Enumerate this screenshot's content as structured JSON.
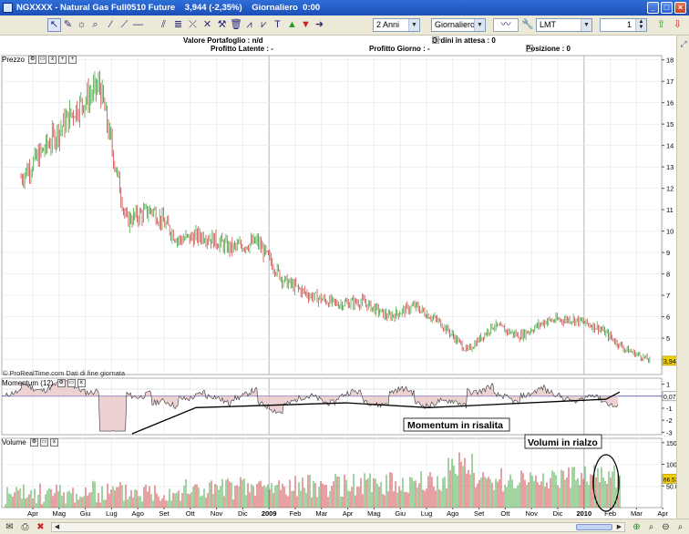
{
  "window": {
    "title": "NGXXXX - Natural Gas Full0510 Future",
    "price_change": "3,944 (-2,35%)",
    "timeframe": "Giornaliero",
    "time": "0:00"
  },
  "toolbar": {
    "period_select": "2 Anni",
    "interval_select": "Giornaliero",
    "order_type_select": "LMT",
    "quantity": "1"
  },
  "info": {
    "valore_portafoglio": "Valore Portafoglio : n/d",
    "profitto_latente": "Profitto Latente : -",
    "profitto_giorno": "Profitto Giorno : -",
    "ordini_in_attesa": "Ordini in attesa : 0",
    "posizione": "Posizione : 0"
  },
  "panels": {
    "price_label": "Prezzo",
    "momentum_label": "Momentum (12)",
    "volume_label": "Volume",
    "source_note": "© ProRealTime.com  Dati di fine giornata"
  },
  "annotations": {
    "momentum": "Momentum in risalita",
    "volume": "Volumi in rialzo"
  },
  "colors": {
    "up": "#44aa44",
    "down": "#cc4444",
    "grid": "#e6e6e6",
    "last_price_bg": "#f2d100"
  },
  "chart_data": [
    {
      "type": "candlestick",
      "name": "Prezzo",
      "y_ticks": [
        4,
        5,
        6,
        7,
        8,
        9,
        10,
        11,
        12,
        13,
        14,
        15,
        16,
        17,
        18
      ],
      "ylim": [
        3.3,
        18.2
      ],
      "last_price": "3,944",
      "x": [
        "2008-04",
        "2008-05",
        "2008-06",
        "2008-07",
        "2008-08",
        "2008-09",
        "2008-10",
        "2008-11",
        "2008-12",
        "2009-01",
        "2009-02",
        "2009-03",
        "2009-04",
        "2009-05",
        "2009-06",
        "2009-07",
        "2009-08",
        "2009-09",
        "2009-10",
        "2009-11",
        "2009-12",
        "2010-01",
        "2010-02",
        "2010-03",
        "2010-04"
      ],
      "close": [
        12.5,
        14.0,
        15.6,
        16.8,
        10.5,
        11.0,
        9.6,
        9.8,
        9.2,
        9.5,
        7.7,
        7.0,
        6.6,
        6.7,
        6.0,
        6.5,
        5.7,
        4.4,
        5.6,
        5.1,
        5.8,
        5.9,
        5.5,
        4.5,
        3.944
      ]
    },
    {
      "type": "line",
      "name": "Momentum (12)",
      "y_ticks": [
        1,
        0,
        -1,
        -2,
        -3
      ],
      "ylim": [
        -3.2,
        1.5
      ],
      "last_value": "0,075"
    },
    {
      "type": "bar",
      "name": "Volume",
      "y_ticks": [
        "150.000",
        "100.000",
        "50.000"
      ],
      "ylim": [
        0,
        160000
      ],
      "last_value": "66.538"
    }
  ],
  "x_axis_labels": [
    "Apr",
    "Mag",
    "Giu",
    "Lug",
    "Ago",
    "Set",
    "Ott",
    "Nov",
    "Dic",
    "2009",
    "Feb",
    "Mar",
    "Apr",
    "Mag",
    "Giu",
    "Lug",
    "Ago",
    "Set",
    "Ott",
    "Nov",
    "Dic",
    "2010",
    "Feb",
    "Mar",
    "Apr",
    "Mag",
    "Giu"
  ],
  "icons": {
    "toolbar": [
      "cursor-icon",
      "pencil-icon",
      "alarm-icon",
      "zoom-icon",
      "line-icon",
      "trendline-icon",
      "channel-icon",
      "fibonacci-icon",
      "gann-icon",
      "cross-icon",
      "trash-icon",
      "indicator-icon",
      "text-icon",
      "buy-arrow-icon",
      "sell-arrow-icon",
      "close-position-icon"
    ],
    "statusbar": [
      "mail-icon",
      "print-icon",
      "delete-icon",
      "scroll-left-icon",
      "scroll-right-icon",
      "zoom-in-icon",
      "zoom-out-icon"
    ]
  }
}
